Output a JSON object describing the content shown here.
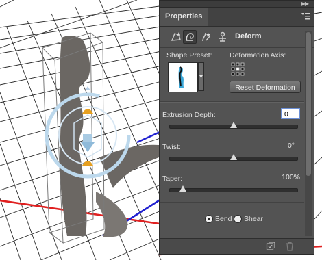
{
  "panel": {
    "title": "Properties",
    "mode_label": "Deform",
    "mode_icons": [
      "mesh-icon",
      "deform-icon",
      "cap-icon",
      "coordinates-icon"
    ],
    "shape_preset_label": "Shape Preset:",
    "deformation_axis_label": "Deformation Axis:",
    "reset_button": "Reset Deformation",
    "extrusion_depth": {
      "label": "Extrusion Depth:",
      "value": "0",
      "slider": 0.5
    },
    "twist": {
      "label": "Twist:",
      "value": "0°",
      "slider": 0.5
    },
    "taper": {
      "label": "Taper:",
      "value": "100%",
      "slider": 0.1
    },
    "radios": [
      {
        "label": "Bend",
        "selected": true
      },
      {
        "label": "Shear",
        "selected": false
      }
    ]
  },
  "colors": {
    "panel_bg": "#535353",
    "axis_red": "#e02020",
    "axis_blue": "#2020d0",
    "shape_shadow": "#6b6763",
    "widget_blue": "#bcd8ec"
  }
}
